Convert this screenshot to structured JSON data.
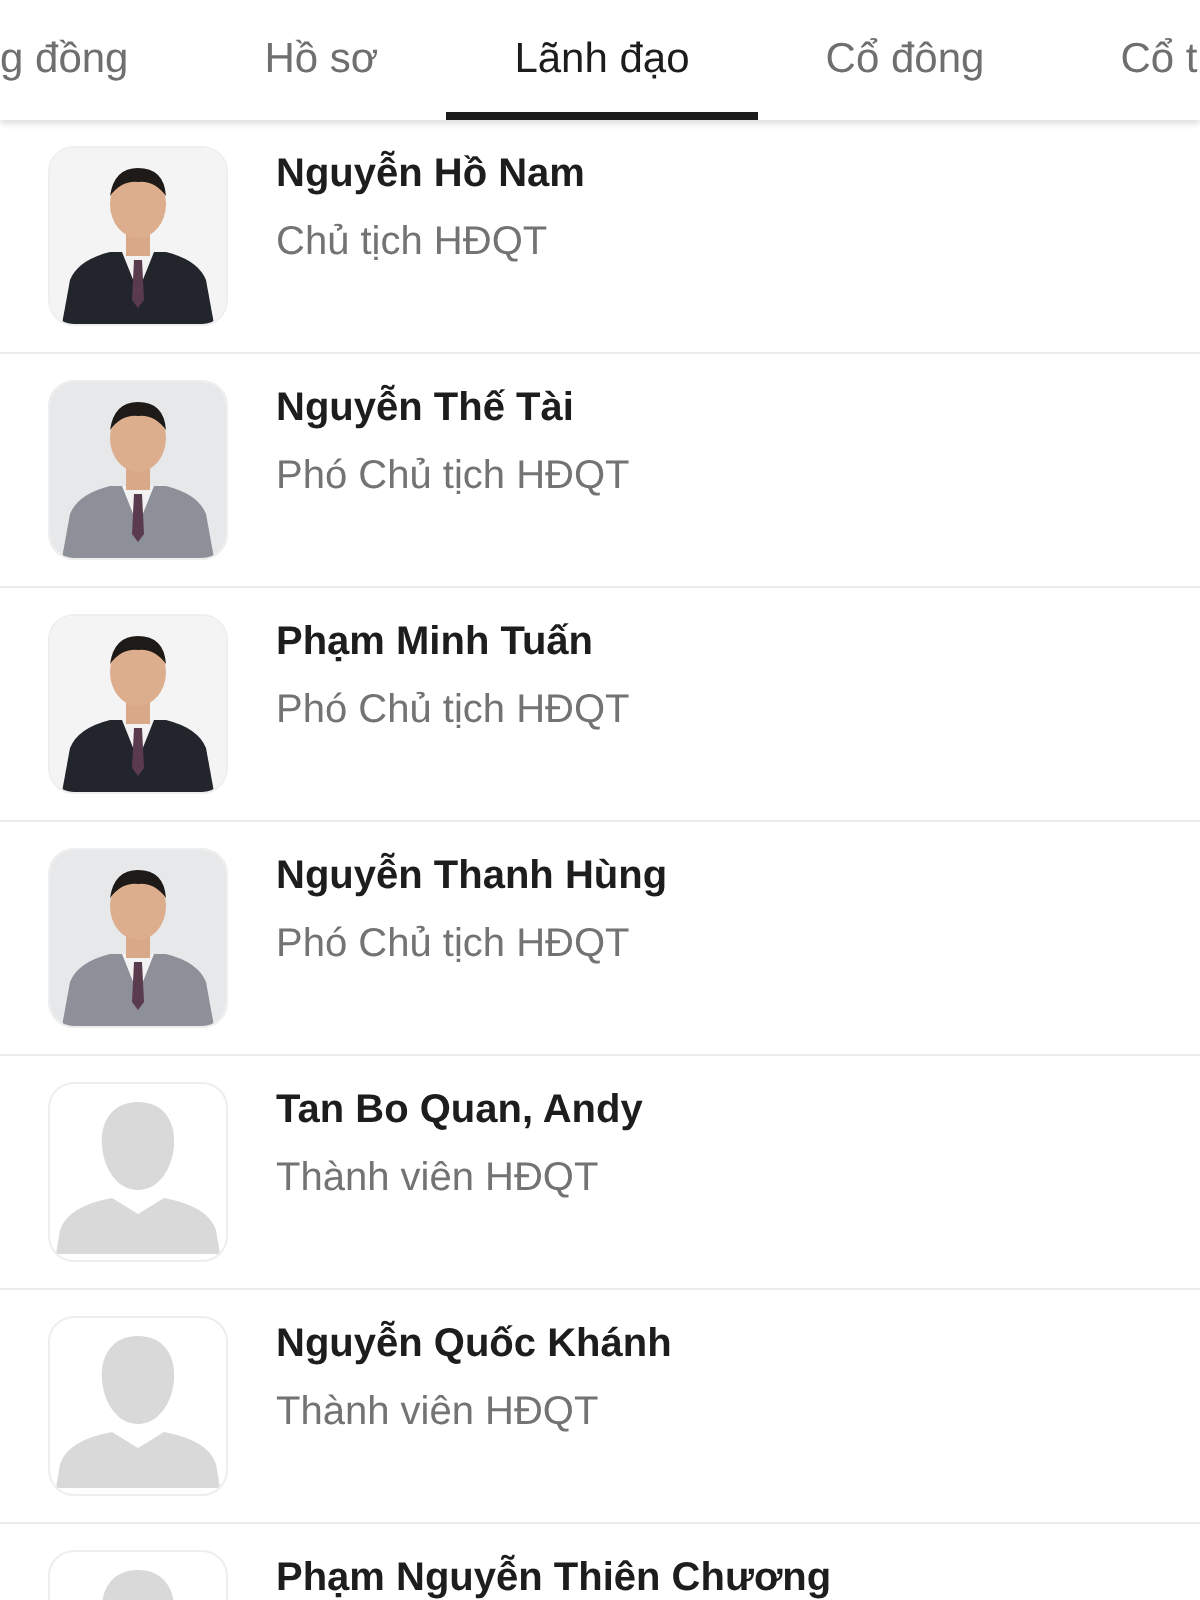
{
  "tabs": [
    {
      "label": "g đồng",
      "selected": false
    },
    {
      "label": "Hồ sơ",
      "selected": false
    },
    {
      "label": "Lãnh đạo",
      "selected": true
    },
    {
      "label": "Cổ đông",
      "selected": false
    },
    {
      "label": "Cổ t",
      "selected": false
    }
  ],
  "leaders": [
    {
      "name": "Nguyễn Hồ Nam",
      "role": "Chủ tịch HĐQT"
    },
    {
      "name": "Nguyễn Thế Tài",
      "role": "Phó Chủ tịch HĐQT"
    },
    {
      "name": "Phạm Minh Tuấn",
      "role": "Phó Chủ tịch HĐQT"
    },
    {
      "name": "Nguyễn Thanh Hùng",
      "role": "Phó Chủ tịch HĐQT"
    },
    {
      "name": "Tan Bo Quan, Andy",
      "role": "Thành viên HĐQT",
      "kind": "placeholder"
    },
    {
      "name": "Nguyễn Quốc Khánh",
      "role": "Thành viên HĐQT",
      "kind": "placeholder"
    },
    {
      "name": "Phạm Nguyễn Thiên Chương",
      "kind": "placeholder"
    }
  ]
}
